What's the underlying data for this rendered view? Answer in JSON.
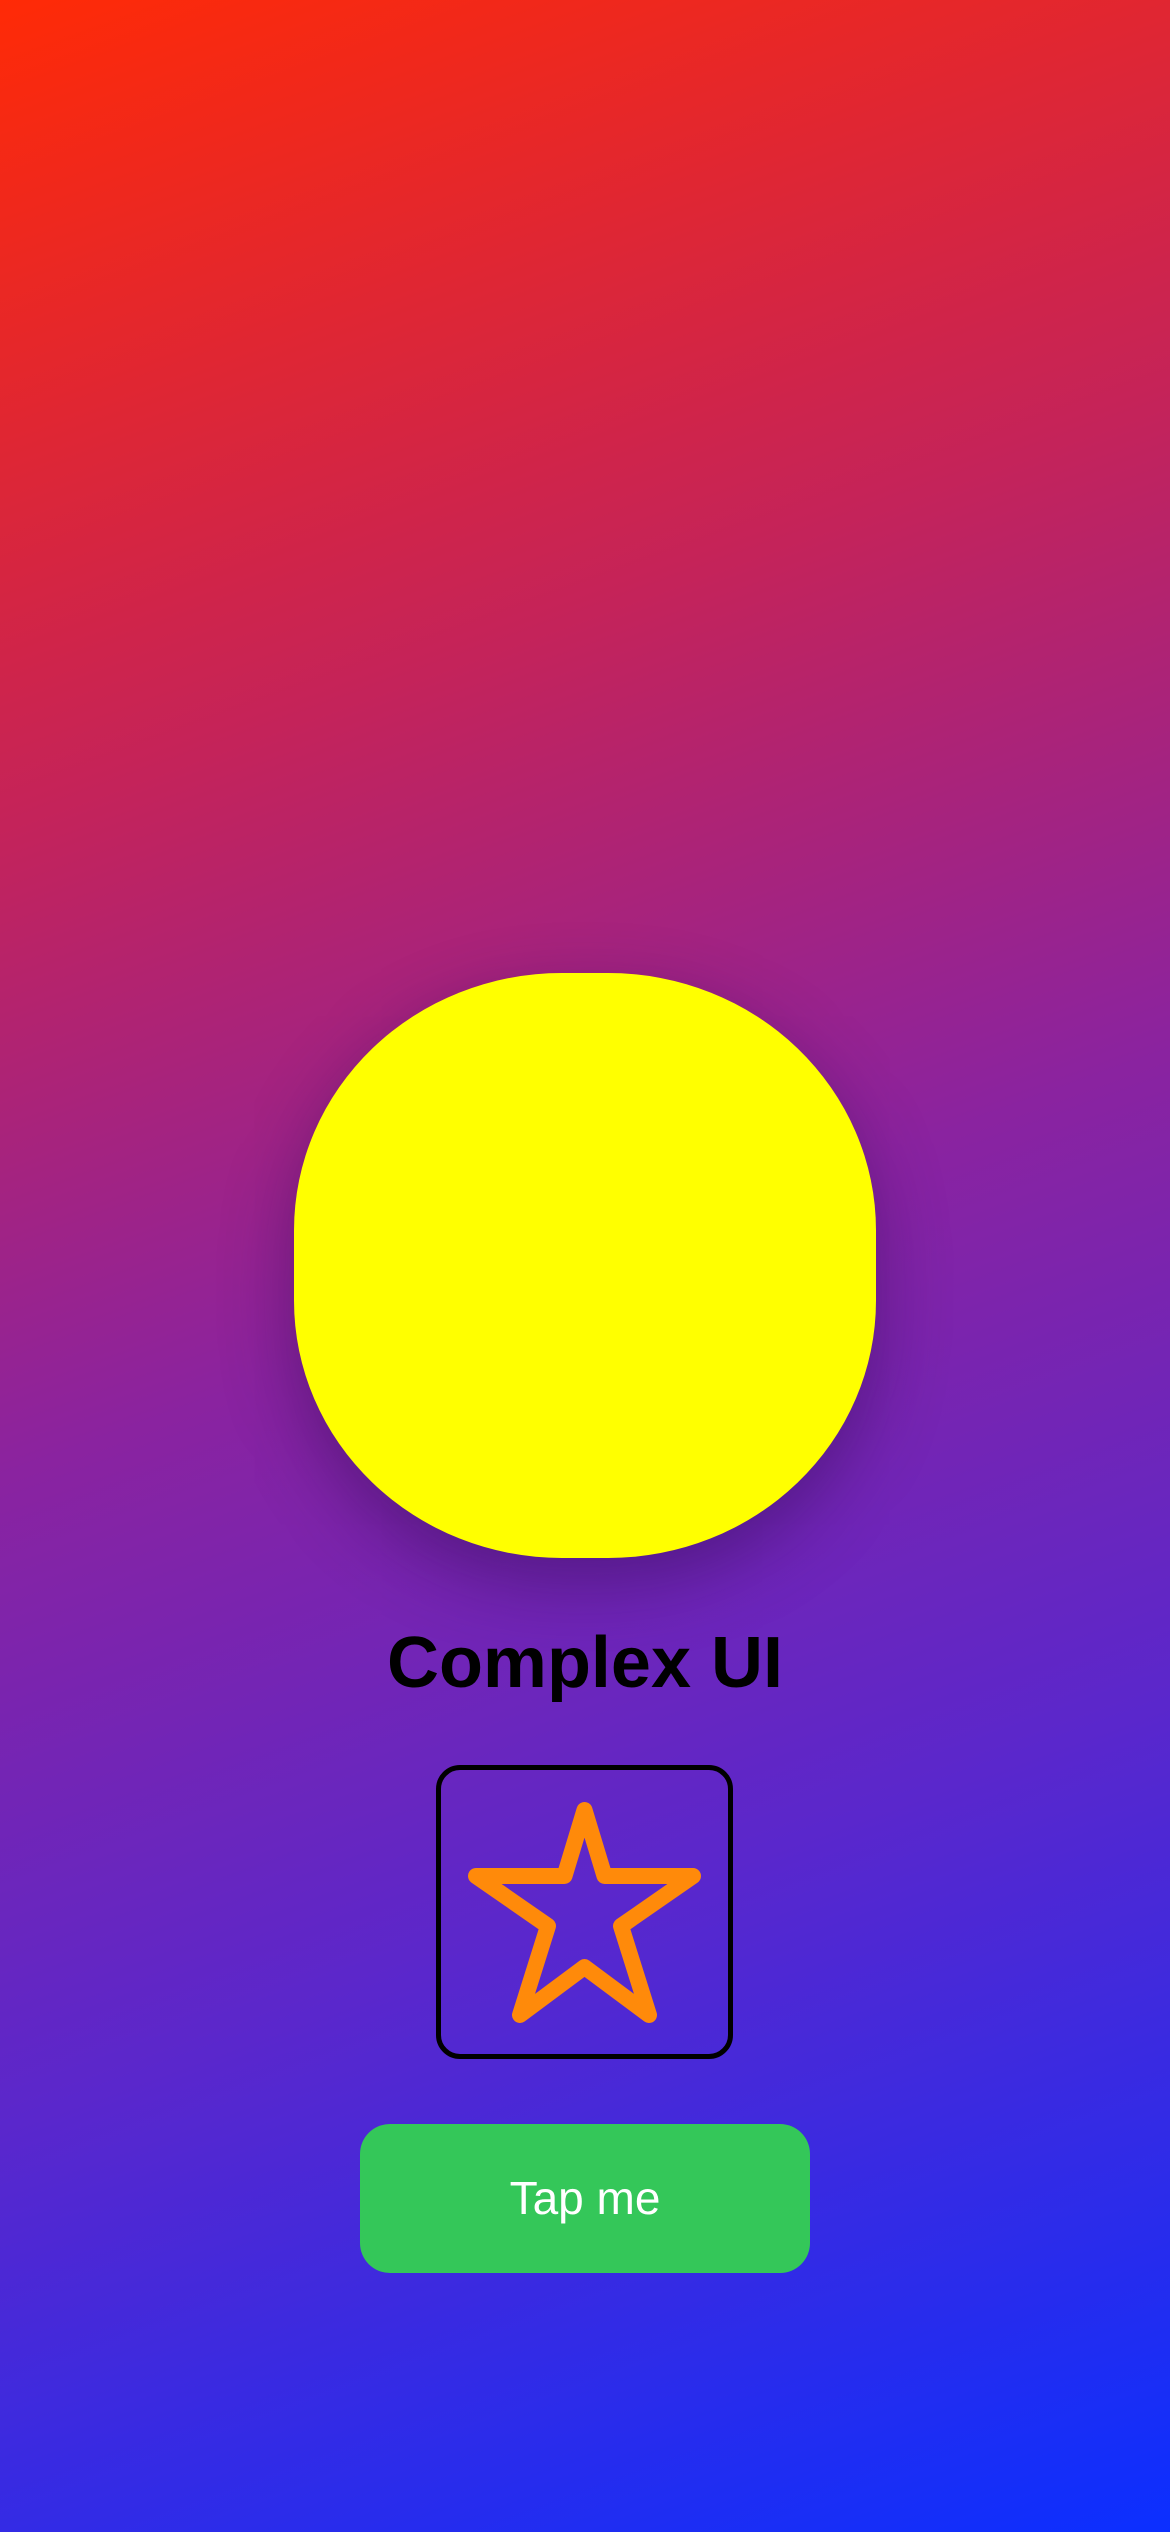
{
  "title": "Complex UI",
  "button": {
    "label": "Tap me"
  },
  "icons": {
    "star": "star-outline-icon"
  },
  "colors": {
    "gradient_start": "#ff2a06",
    "gradient_end": "#0b2fff",
    "blob": "#ffff00",
    "star_stroke": "#ff8a0a",
    "button_bg": "#34c759",
    "button_text": "#ffffff",
    "title_text": "#000000"
  }
}
